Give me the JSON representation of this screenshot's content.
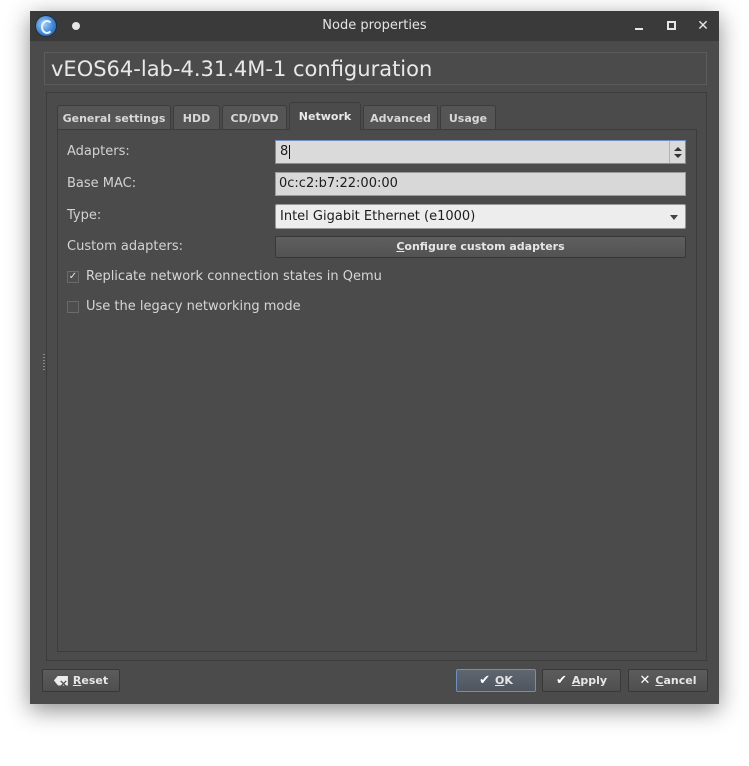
{
  "window": {
    "title": "Node properties"
  },
  "dialog": {
    "heading": "vEOS64-lab-4.31.4M-1 configuration"
  },
  "tabs": [
    {
      "label": "General settings"
    },
    {
      "label": "HDD"
    },
    {
      "label": "CD/DVD"
    },
    {
      "label": "Network",
      "active": true
    },
    {
      "label": "Advanced"
    },
    {
      "label": "Usage"
    }
  ],
  "network": {
    "adapters_label": "Adapters:",
    "adapters_value": "8",
    "base_mac_label": "Base MAC:",
    "base_mac_value": "0c:c2:b7:22:00:00",
    "type_label": "Type:",
    "type_value": "Intel Gigabit Ethernet (e1000)",
    "custom_adapters_label": "Custom adapters:",
    "configure_button": {
      "mnemonic": "C",
      "rest": "onfigure custom adapters"
    },
    "replicate": {
      "label": "Replicate network connection states in Qemu",
      "checked": true,
      "mark": "✓"
    },
    "legacy": {
      "label": "Use the legacy networking mode",
      "checked": false
    }
  },
  "footer": {
    "reset": {
      "mnemonic": "R",
      "rest": "eset"
    },
    "ok": {
      "mnemonic": "O",
      "rest": "K"
    },
    "apply": {
      "mnemonic": "A",
      "rest": "pply"
    },
    "cancel": {
      "mnemonic": "C",
      "rest": "ancel"
    }
  }
}
